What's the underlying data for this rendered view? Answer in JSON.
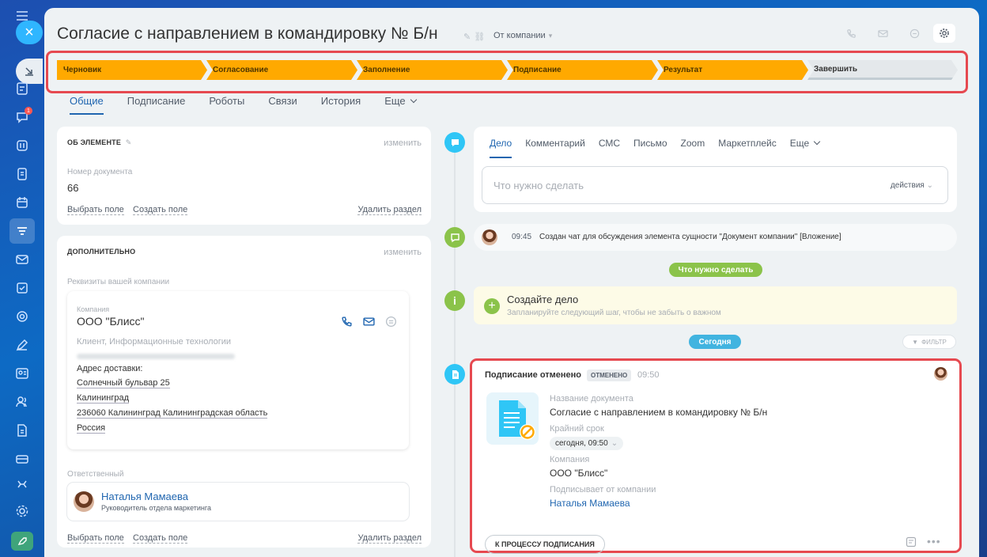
{
  "header": {
    "title": "Согласие с направлением в командировку № Б/н",
    "from_company": "От компании"
  },
  "stages": [
    {
      "label": "Черновик"
    },
    {
      "label": "Согласование"
    },
    {
      "label": "Заполнение"
    },
    {
      "label": "Подписание"
    },
    {
      "label": "Результат"
    },
    {
      "label": "Завершить"
    }
  ],
  "tabs": [
    "Общие",
    "Подписание",
    "Роботы",
    "Связи",
    "История",
    "Еще"
  ],
  "about": {
    "title": "ОБ ЭЛЕМЕНТЕ",
    "edit": "изменить",
    "doc_number_label": "Номер документа",
    "doc_number": "66",
    "select_field": "Выбрать поле",
    "create_field": "Создать поле",
    "delete_section": "Удалить раздел"
  },
  "extra": {
    "title": "ДОПОЛНИТЕЛЬНО",
    "edit": "изменить",
    "requisites_label": "Реквизиты вашей компании",
    "company_label": "Компания",
    "company_name": "ООО \"Блисс\"",
    "client_type": "Клиент, Информационные технологии",
    "delivery_label": "Адрес доставки:",
    "addr_street": "Солнечный бульвар 25",
    "addr_city": "Калининград",
    "addr_zip": "236060 Калининград Калининградская область",
    "addr_country": "Россия",
    "responsible_label": "Ответственный",
    "responsible_name": "Наталья Мамаева",
    "responsible_role": "Руководитель отдела маркетинга",
    "select_field": "Выбрать поле",
    "create_field": "Создать поле",
    "delete_section": "Удалить раздел"
  },
  "todo": {
    "tabs": [
      "Дело",
      "Комментарий",
      "СМС",
      "Письмо",
      "Zoom",
      "Маркетплейс",
      "Еще"
    ],
    "placeholder": "Что нужно сделать",
    "actions": "действия"
  },
  "chat_event": {
    "time": "09:45",
    "text": "Создан чат для обсуждения элемента сущности \"Документ компании\" [Вложение]"
  },
  "what_to_do_pill": "Что нужно сделать",
  "create_task": {
    "title": "Создайте дело",
    "subtitle": "Запланируйте следующий шаг, чтобы не забыть о важном"
  },
  "today_pill": "Сегодня",
  "filter": "ФИЛЬТР",
  "signing": {
    "title": "Подписание отменено",
    "badge": "ОТМЕНЕНО",
    "time": "09:50",
    "doc_name_label": "Название документа",
    "doc_name": "Согласие с направлением в командировку № Б/н",
    "deadline_label": "Крайний срок",
    "deadline": "сегодня, 09:50",
    "company_label": "Компания",
    "company": "ООО \"Блисс\"",
    "signer_label": "Подписывает от компании",
    "signer": "Наталья Мамаева",
    "process_button": "К ПРОЦЕССУ ПОДПИСАНИЯ"
  },
  "colors": {
    "stage": "#ffa900",
    "accent": "#2066b0",
    "green": "#8bc34a",
    "today": "#41b4e0",
    "highlight": "#e64950"
  }
}
